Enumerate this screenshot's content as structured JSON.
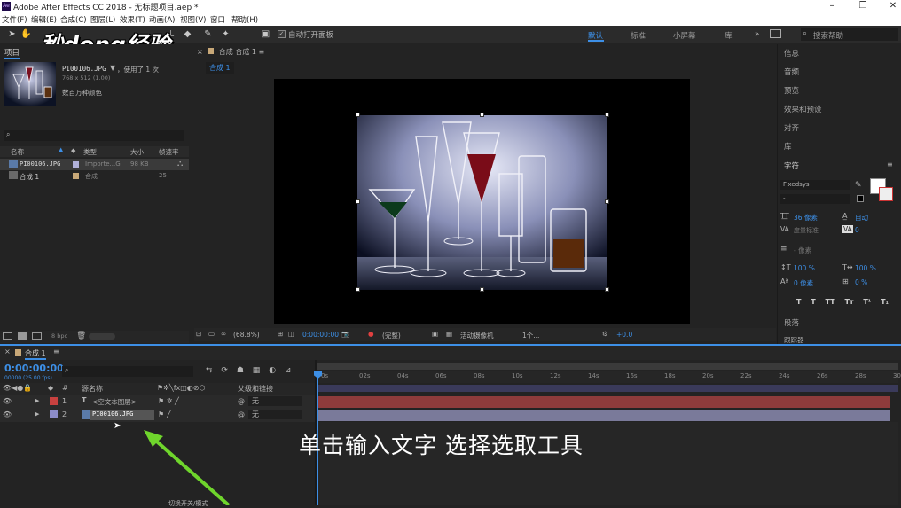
{
  "window": {
    "title": "Adobe After Effects CC 2018 - 无标题项目.aep *",
    "logo": "Ae"
  },
  "menu": [
    "文件(F)",
    "编辑(E)",
    "合成(C)",
    "图层(L)",
    "效果(T)",
    "动画(A)",
    "视图(V)",
    "窗口",
    "帮助(H)"
  ],
  "toolbar": {
    "auto_open_label": "自动打开面板",
    "workspaces": [
      "默认",
      "标准",
      "小屏幕",
      "库"
    ],
    "search_placeholder": "搜索帮助",
    "more": "»"
  },
  "watermark": "秒dong经验",
  "project": {
    "tab_label": "项目",
    "selected_name": "PI00106.JPG",
    "usage": "，使用了 1 次",
    "dimensions": "768 x 512 (1.00)",
    "color_info": "数百万种颜色",
    "columns": [
      "名称",
      "类型",
      "大小",
      "帧速率"
    ],
    "items": [
      {
        "name": "PI00106.JPG",
        "type": "Importe...G",
        "size": "98 KB",
        "fps": ""
      },
      {
        "name": "合成 1",
        "type": "合成",
        "size": "",
        "fps": "25"
      }
    ],
    "bpc": "8 bpc"
  },
  "composition": {
    "panel_title": "合成 合成 1",
    "tab_label": "合成 1",
    "zoom": "(68.8%)",
    "timecode": "0:00:00:00",
    "quality": "(完整)",
    "camera": "活动摄像机",
    "views": "1个...",
    "exposure": "+0.0"
  },
  "right_panel": {
    "items": [
      "信息",
      "音频",
      "预览",
      "效果和预设",
      "对齐",
      "库"
    ],
    "character_title": "字符",
    "font": "Fixedsys",
    "font_style": "-",
    "font_size": "36 像素",
    "leading": "自动",
    "tracking_metric": "度量标准",
    "tracking": "0",
    "stroke_width": "- 像素",
    "vscale": "100 %",
    "hscale": "100 %",
    "baseline": "0 像素",
    "tsume": "0 %",
    "paragraph": "段落",
    "styles": [
      "T",
      "T",
      "TT",
      "Tт",
      "T¹",
      "T₁"
    ],
    "trailing": "跟踪器"
  },
  "timeline": {
    "tab_label": "合成 1",
    "timecode": "0:00:00:00",
    "fps_note": "00000 (25.00 fps)",
    "headers": {
      "num": "#",
      "source": "源名称",
      "parent": "父级和链接"
    },
    "layers": [
      {
        "num": "1",
        "type": "T",
        "name": "<空文本图层>",
        "parent": "无",
        "color": "#c8413f"
      },
      {
        "num": "2",
        "type": "img",
        "name": "PI00106.JPG",
        "parent": "无",
        "color": "#8c8cc8"
      }
    ],
    "ticks": [
      "0s",
      "02s",
      "04s",
      "06s",
      "08s",
      "10s",
      "12s",
      "14s",
      "16s",
      "18s",
      "20s",
      "22s",
      "24s",
      "26s",
      "28s",
      "30s"
    ],
    "bottom_label": "切换开关/模式"
  },
  "subtitle": "单击输入文字  选择选取工具",
  "colors": {
    "accent": "#3d8fe6",
    "layer1_track": "#8e3b3b",
    "layer2_track": "#7a7a9a",
    "arrow": "#6fd52c"
  }
}
